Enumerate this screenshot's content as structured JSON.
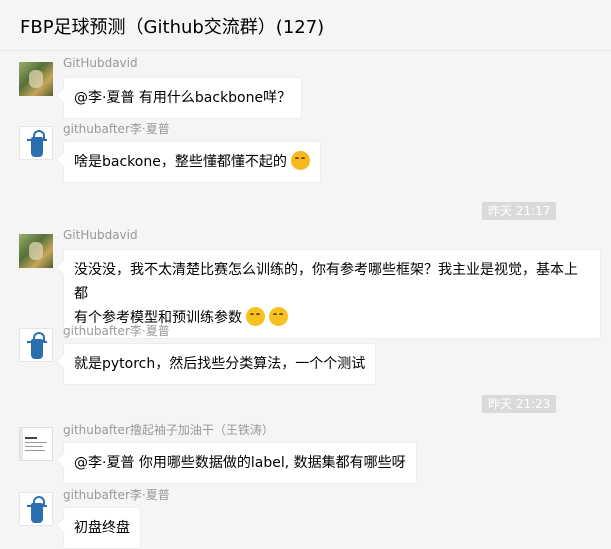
{
  "chat": {
    "title": "FBP足球预测（Github交流群）(127)"
  },
  "messages": [
    {
      "sender": "GitHubdavid",
      "text": "@李·夏普 有用什么backbone咩？"
    },
    {
      "sender": "githubafter李·夏普",
      "text": "啥是backone，整些懂都懂不起的"
    },
    {
      "sender": "GitHubdavid",
      "line1": "没没没，我不太清楚比赛怎么训练的，你有参考哪些框架？我主业是视觉，基本上都",
      "line2": "有个参考模型和预训练参数"
    },
    {
      "sender": "githubafter李·夏普",
      "text": "就是pytorch，然后找些分类算法，一个个测试"
    },
    {
      "sender": "githubafter撸起袖子加油干（王铁涛）",
      "text": "@李·夏普 你用哪些数据做的label, 数据集都有哪些呀"
    },
    {
      "sender": "githubafter李·夏普",
      "text": "初盘终盘"
    }
  ],
  "timestamps": [
    "昨天 21:17",
    "昨天 21:23"
  ],
  "icons": {
    "avatar_1": "game-avatar",
    "avatar_2": "apron-avatar",
    "avatar_3": "paper-avatar",
    "emoji_laugh": "rolling-laugh-emoji",
    "emoji_think": "thinking-emoji"
  },
  "colors": {
    "background": "#f5f5f5",
    "bubble": "#ffffff",
    "timestamp_bg": "#dadada",
    "sender_name": "#999999"
  }
}
